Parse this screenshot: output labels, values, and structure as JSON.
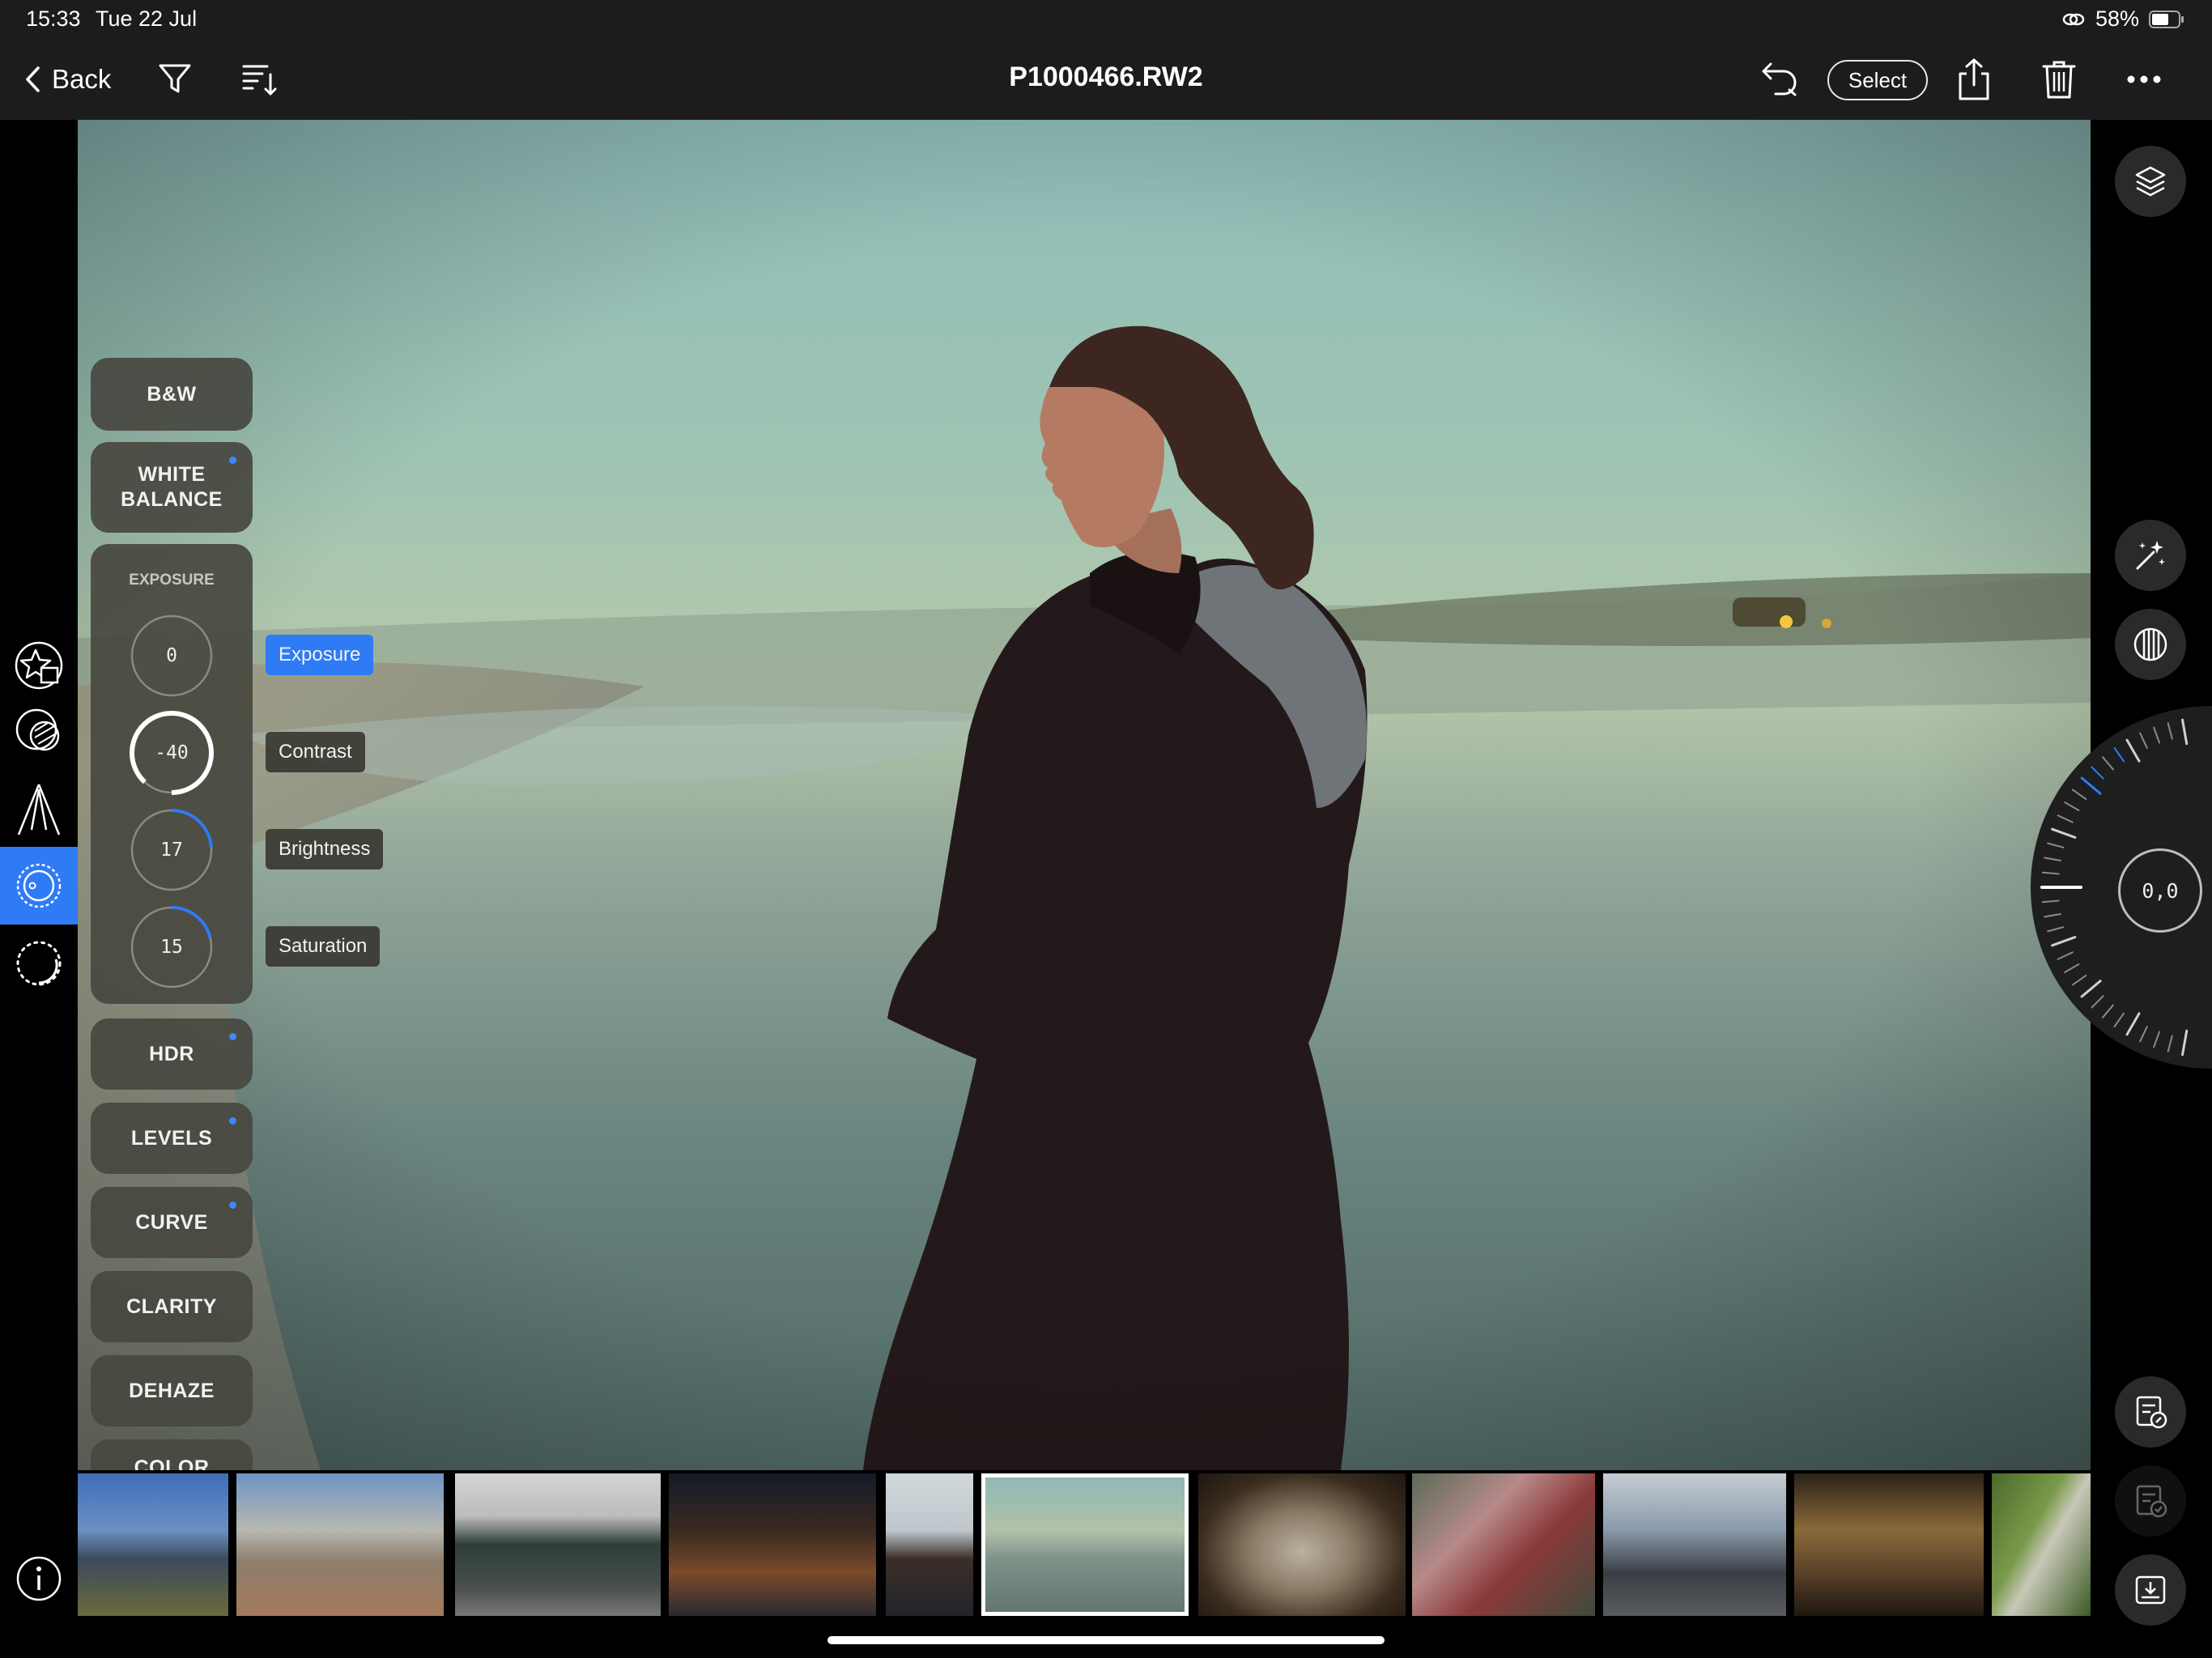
{
  "status_bar": {
    "time": "15:33",
    "date": "Tue 22 Jul",
    "battery": "58%"
  },
  "toolbar": {
    "back_label": "Back",
    "title": "P1000466.RW2",
    "select_label": "Select"
  },
  "panel": {
    "bw": "B&W",
    "white_balance": "WHITE\nBALANCE",
    "exposure_header": "EXPOSURE",
    "dials": [
      {
        "value": "0",
        "label": "Exposure",
        "level": 0
      },
      {
        "value": "-40",
        "label": "Contrast",
        "level": -0.4
      },
      {
        "value": "17",
        "label": "Brightness",
        "level": 0.17
      },
      {
        "value": "15",
        "label": "Saturation",
        "level": 0.15
      }
    ],
    "hdr": "HDR",
    "levels": "LEVELS",
    "curve": "CURVE",
    "clarity": "CLARITY",
    "dehaze": "DEHAZE",
    "color": "COLOR"
  },
  "wheel": {
    "value": "0,0"
  },
  "colors": {
    "accent": "#2f7bf5",
    "panel": "#484840",
    "toolbar": "#1c1c1e"
  },
  "filmstrip": {
    "thumbnails": [
      "city-skyline",
      "fountain-park",
      "green-mini-car",
      "night-street",
      "woman-snow",
      "woman-beach",
      "window-beach",
      "red-leaves",
      "vintage-airplane",
      "cockpit",
      "forest-path"
    ],
    "selected_index": 5
  }
}
